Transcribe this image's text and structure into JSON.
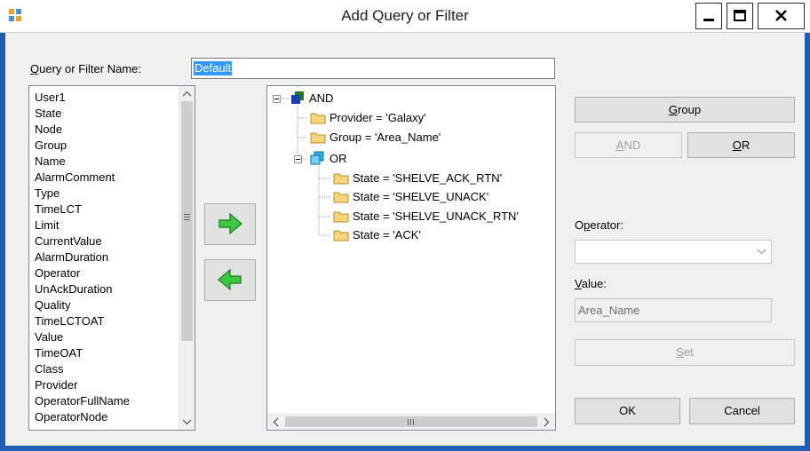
{
  "window": {
    "title": "Add Query or Filter",
    "controls": [
      "minimize",
      "maximize",
      "close"
    ]
  },
  "name_field": {
    "label": "Query or Filter Name:",
    "mnemonic": "Q",
    "value": "Default"
  },
  "columns": {
    "items": [
      "User1",
      "State",
      "Node",
      "Group",
      "Name",
      "AlarmComment",
      "Type",
      "TimeLCT",
      "Limit",
      "CurrentValue",
      "AlarmDuration",
      "Operator",
      "UnAckDuration",
      "Quality",
      "TimeLCTOAT",
      "Value",
      "TimeOAT",
      "Class",
      "Provider",
      "OperatorFullName",
      "OperatorNode"
    ]
  },
  "arrows": {
    "add": "right-arrow-icon",
    "remove": "left-arrow-icon"
  },
  "tree": {
    "root": "AND",
    "children": [
      "Provider = 'Galaxy'",
      "Group = 'Area_Name'"
    ],
    "subgroup": "OR",
    "subchildren": [
      "State = 'SHELVE_ACK_RTN'",
      "State = 'SHELVE_UNACK'",
      "State = 'SHELVE_UNACK_RTN'",
      "State = 'ACK'"
    ]
  },
  "buttons": {
    "group": "Group",
    "and": "AND",
    "or": "OR",
    "set": "Set",
    "ok": "OK",
    "cancel": "Cancel"
  },
  "operator": {
    "label": "Operator:",
    "value": ""
  },
  "value_field": {
    "label": "Value:",
    "value": "Area_Name"
  },
  "colors": {
    "accent": "#1a5fb4",
    "selection": "#3399ff",
    "arrow_green": "#3cc83c"
  }
}
